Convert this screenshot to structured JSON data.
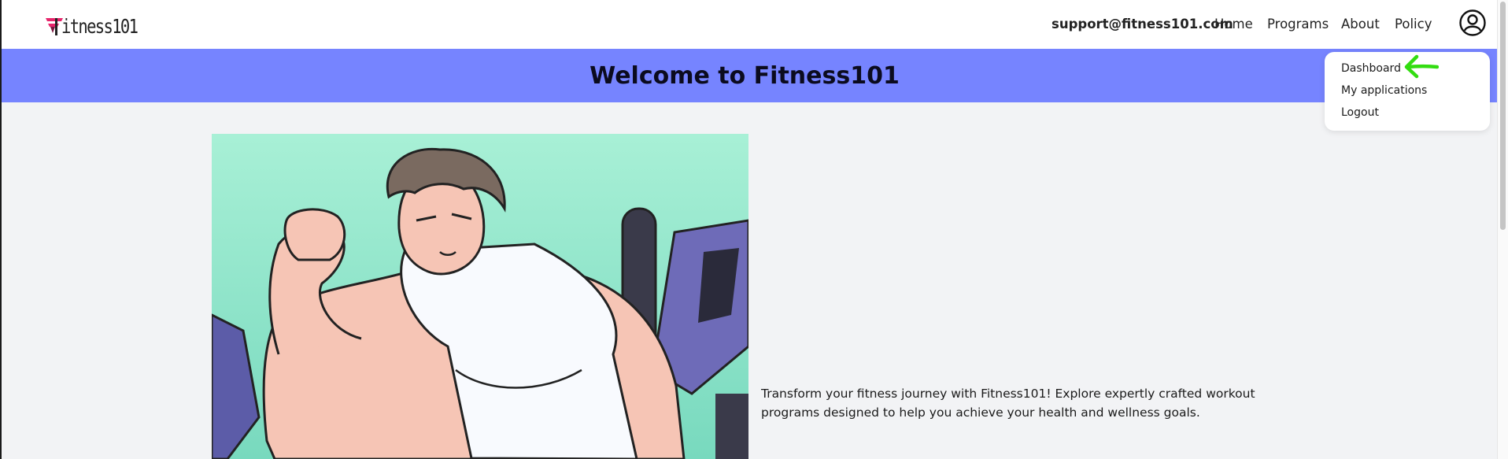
{
  "brand": {
    "logo_text": "itness101",
    "logo_accent": "#e6256b"
  },
  "nav": {
    "email": "support@fitness101.com",
    "home": "Home",
    "programs": "Programs",
    "about": "About",
    "policy": "Policy"
  },
  "banner": {
    "title": "Welcome to Fitness101",
    "color": "#7684ff"
  },
  "user_menu": {
    "items": [
      "Dashboard",
      "My applications",
      "Logout"
    ]
  },
  "intro": {
    "text": "Transform your fitness journey with Fitness101! Explore expertly crafted workout programs designed to help you achieve your health and wellness goals."
  },
  "annotation": {
    "color": "#33dd11",
    "icon": "arrow-left-icon"
  }
}
